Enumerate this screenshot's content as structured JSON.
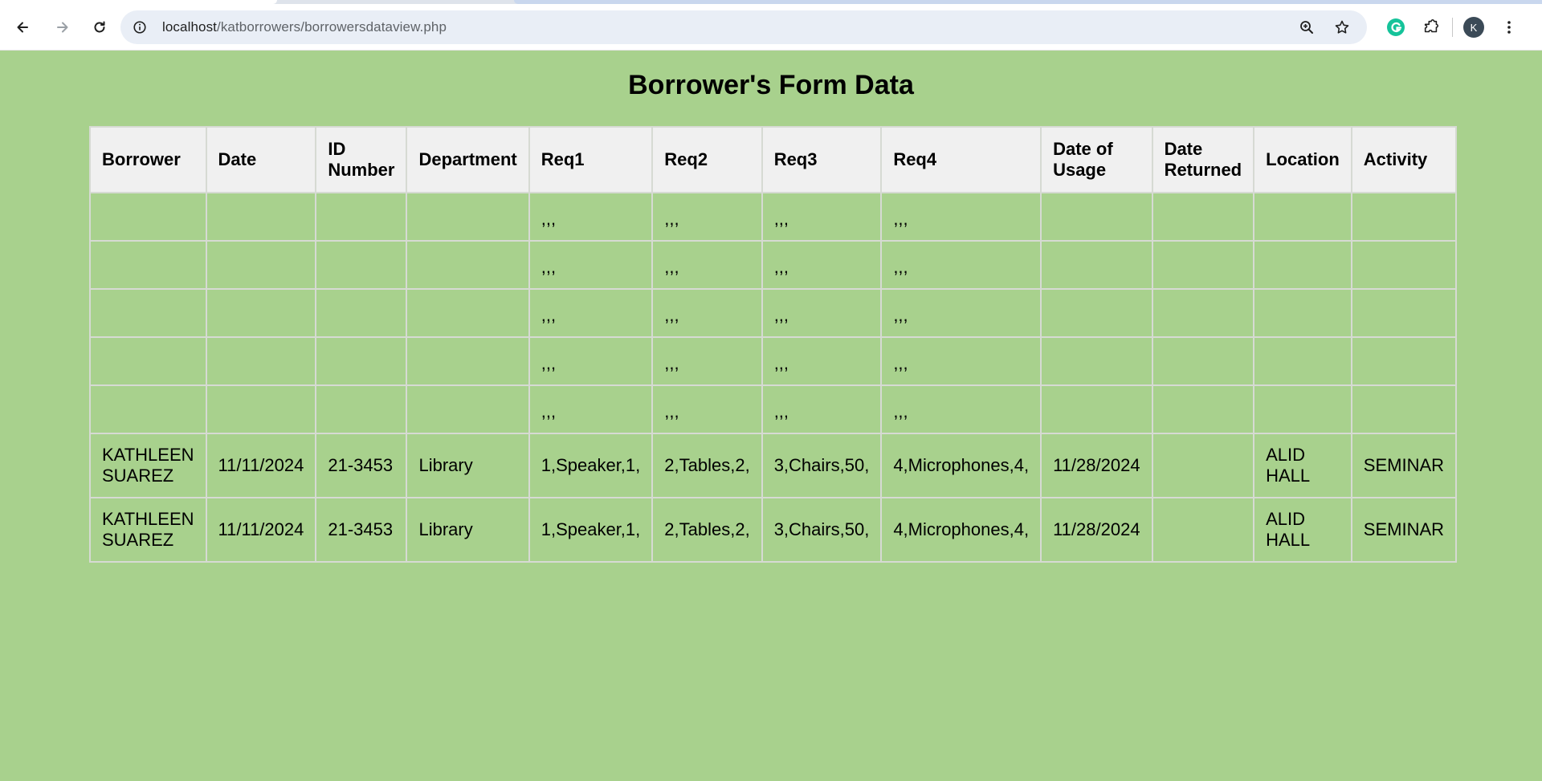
{
  "browser": {
    "url_host": "localhost",
    "url_path": "/katborrowers/borrowersdataview.php",
    "profile_initial": "K"
  },
  "page": {
    "title": "Borrower's Form Data"
  },
  "table": {
    "headers": [
      "Borrower",
      "Date",
      "ID Number",
      "Department",
      "Req1",
      "Req2",
      "Req3",
      "Req4",
      "Date of Usage",
      "Date Returned",
      "Location",
      "Activity"
    ],
    "rows": [
      [
        "",
        "",
        "",
        "",
        ",,,",
        ",,,",
        ",,,",
        ",,,",
        "",
        "",
        "",
        ""
      ],
      [
        "",
        "",
        "",
        "",
        ",,,",
        ",,,",
        ",,,",
        ",,,",
        "",
        "",
        "",
        ""
      ],
      [
        "",
        "",
        "",
        "",
        ",,,",
        ",,,",
        ",,,",
        ",,,",
        "",
        "",
        "",
        ""
      ],
      [
        "",
        "",
        "",
        "",
        ",,,",
        ",,,",
        ",,,",
        ",,,",
        "",
        "",
        "",
        ""
      ],
      [
        "",
        "",
        "",
        "",
        ",,,",
        ",,,",
        ",,,",
        ",,,",
        "",
        "",
        "",
        ""
      ],
      [
        "KATHLEEN SUAREZ",
        "11/11/2024",
        "21-3453",
        "Library",
        "1,Speaker,1,",
        "2,Tables,2,",
        "3,Chairs,50,",
        "4,Microphones,4,",
        "11/28/2024",
        "",
        "ALID HALL",
        "SEMINAR"
      ],
      [
        "KATHLEEN SUAREZ",
        "11/11/2024",
        "21-3453",
        "Library",
        "1,Speaker,1,",
        "2,Tables,2,",
        "3,Chairs,50,",
        "4,Microphones,4,",
        "11/28/2024",
        "",
        "ALID HALL",
        "SEMINAR"
      ]
    ]
  },
  "colors": {
    "page_background": "#a8d18d",
    "header_background": "#f0f0f0",
    "grammarly": "#15c39a"
  }
}
